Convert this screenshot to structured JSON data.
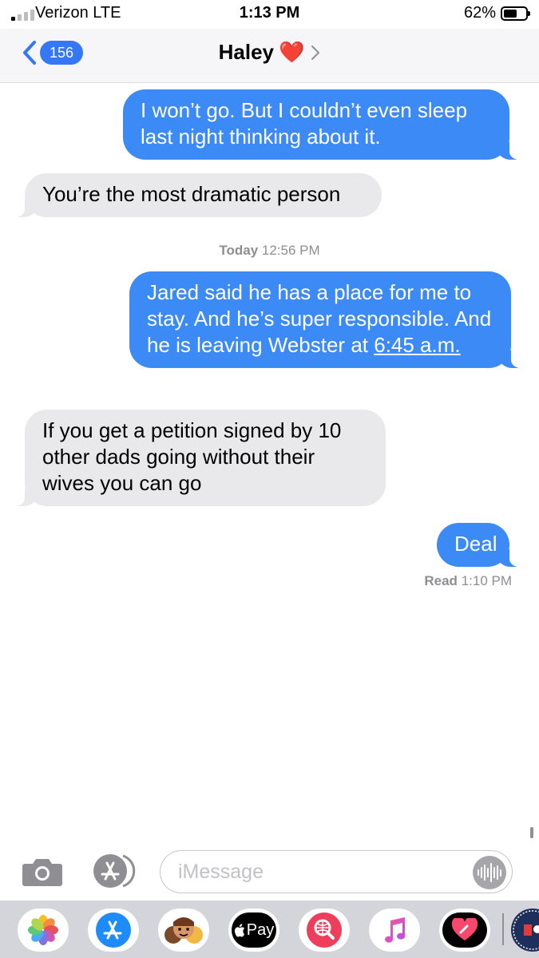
{
  "status_bar": {
    "carrier": "Verizon LTE",
    "time": "1:13 PM",
    "battery_percent": "62%",
    "battery_level": 0.62,
    "signal_bars_active": 1,
    "signal_bars_total": 4
  },
  "header": {
    "back_count": "156",
    "contact_name": "Haley",
    "contact_emoji": "❤️",
    "accent_color": "#3478f6"
  },
  "conversation": {
    "messages": [
      {
        "direction": "sent",
        "text": "I won’t go. But I couldn’t even sleep last night thinking about it."
      },
      {
        "direction": "received",
        "text": "You’re the most dramatic person"
      },
      {
        "direction": "sent",
        "text": "Jared said he has a place for me to stay. And he’s super responsible. And he is leaving Webster at ",
        "link": "6:45 a.m."
      },
      {
        "direction": "received",
        "text": "If you get a petition signed by 10 other dads going without their wives you can go"
      },
      {
        "direction": "sent",
        "text": "Deal"
      }
    ],
    "timestamp": {
      "day": "Today",
      "time": "12:56 PM"
    },
    "read_receipt": {
      "label": "Read",
      "time": "1:10 PM"
    },
    "sent_color": "#3c8af6",
    "received_color": "#e9e9ec"
  },
  "input_bar": {
    "placeholder": "iMessage",
    "camera_icon": "camera-icon",
    "apps_icon": "app-store-icon",
    "audio_icon": "audio-waveform-icon"
  },
  "app_drawer": {
    "apps": [
      {
        "name": "photos-app-icon"
      },
      {
        "name": "app-store-app-icon"
      },
      {
        "name": "memoji-app-icon"
      },
      {
        "name": "apple-pay-app-icon",
        "label": "Pay"
      },
      {
        "name": "web-search-app-icon"
      },
      {
        "name": "music-app-icon"
      },
      {
        "name": "digital-touch-app-icon"
      },
      {
        "name": "more-app-icon"
      }
    ]
  }
}
